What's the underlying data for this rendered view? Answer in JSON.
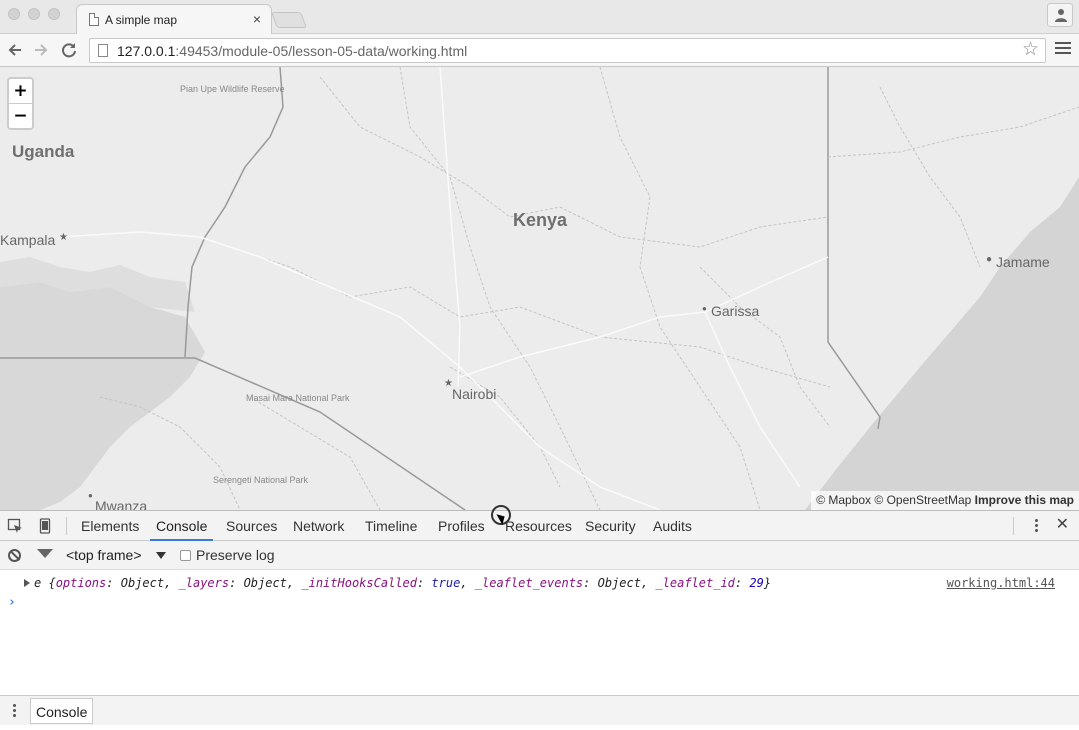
{
  "browser": {
    "tab_title": "A simple map",
    "tab_close": "×",
    "url_host": "127.0.0.1",
    "url_path": ":49453/module-05/lesson-05-data/working.html"
  },
  "map": {
    "zoom_in": "+",
    "zoom_out": "−",
    "labels": {
      "uganda": "Uganda",
      "kenya": "Kenya",
      "kampala": "Kampala",
      "jamame": "Jamame",
      "garissa": "Garissa",
      "nairobi": "Nairobi",
      "mwanza": "Mwanza",
      "pian_upe": "Pian Upe Wildlife Reserve",
      "masai_mara": "Masai Mara National Park",
      "serengeti": "Serengeti National Park"
    },
    "attribution": {
      "mapbox": "© Mapbox",
      "osm": "© OpenStreetMap",
      "improve": "Improve this map"
    }
  },
  "devtools": {
    "tabs": [
      "Elements",
      "Console",
      "Sources",
      "Network",
      "Timeline",
      "Profiles",
      "Resources",
      "Security",
      "Audits"
    ],
    "active_tab": "Console",
    "frame_select": "<top frame>",
    "preserve_log": "Preserve log",
    "log": {
      "prefix": "e {",
      "k1": "options",
      "v1": "Object",
      "k2": "_layers",
      "v2": "Object",
      "k3": "_initHooksCalled",
      "v3": "true",
      "k4": "_leaflet_events",
      "v4": "Object",
      "k5": "_leaflet_id",
      "v5": "29",
      "source": "working.html:44"
    },
    "prompt": "›",
    "drawer_tab": "Console",
    "close": "✕"
  }
}
